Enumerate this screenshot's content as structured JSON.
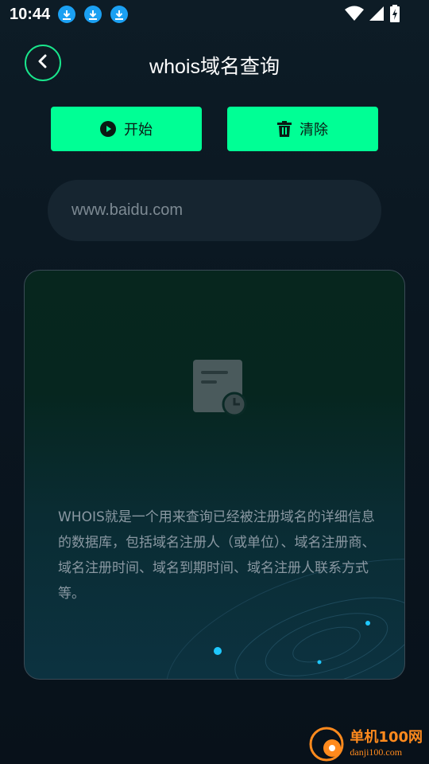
{
  "status_bar": {
    "time": "10:44",
    "notifications": [
      "download-icon",
      "download-icon",
      "download-icon"
    ],
    "icons": [
      "wifi-icon",
      "signal-icon",
      "battery-icon"
    ]
  },
  "header": {
    "back_icon": "chevron-left-icon",
    "title": "whois域名查询"
  },
  "actions": {
    "start_label": "开始",
    "start_icon": "play-circle-icon",
    "clear_label": "清除",
    "clear_icon": "trash-icon"
  },
  "search": {
    "placeholder": "www.baidu.com",
    "value": ""
  },
  "result": {
    "icon": "document-clock-icon",
    "description": "WHOIS就是一个用来查询已经被注册域名的详细信息的数据库，包括域名注册人（或单位）、域名注册商、域名注册时间、域名到期时间、域名注册人联系方式等。"
  },
  "watermark": {
    "main": "单机100网",
    "sub": "danji100.com"
  },
  "colors": {
    "accent": "#00ff95",
    "background": "#0d1c26",
    "card_border": "#3a4a55",
    "text_muted": "#8a98a2"
  }
}
